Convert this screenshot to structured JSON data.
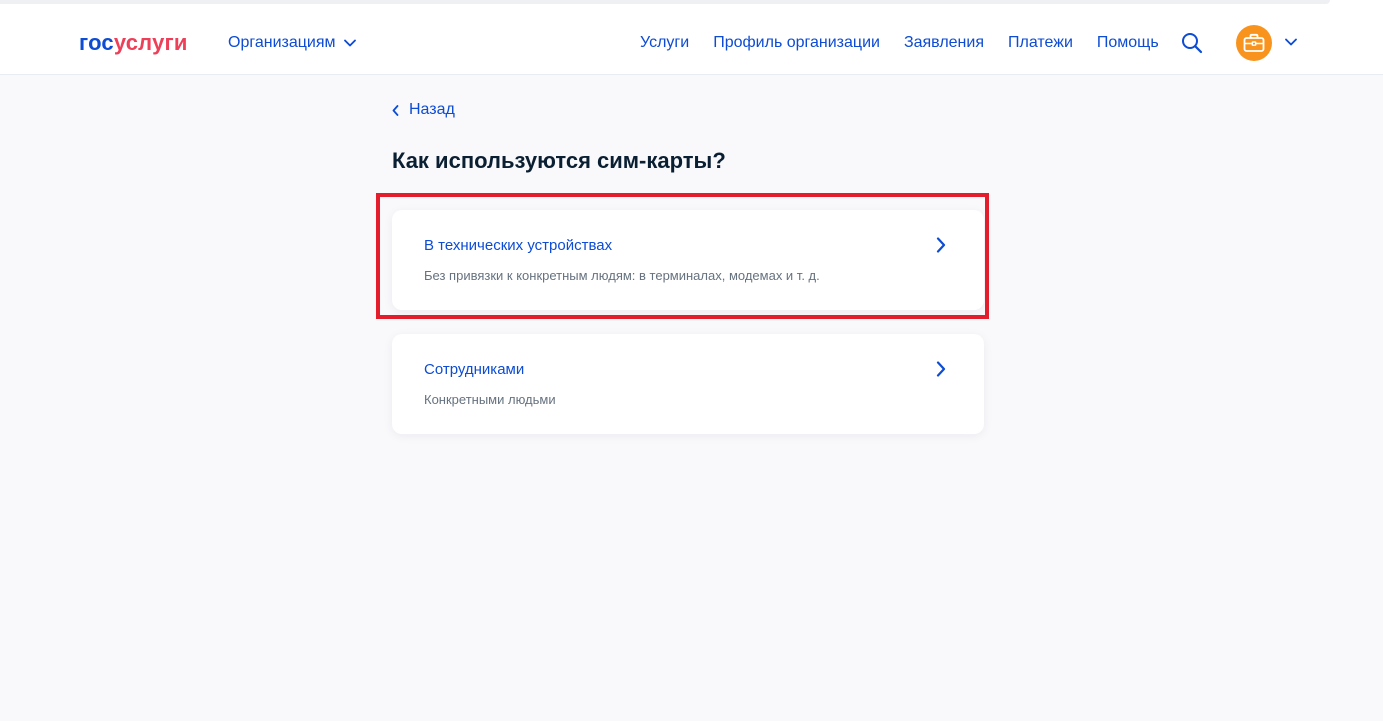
{
  "logo": {
    "part1": "гос",
    "part2": "услуги"
  },
  "header": {
    "org_menu_label": "Организациям",
    "nav": [
      "Услуги",
      "Профиль организации",
      "Заявления",
      "Платежи",
      "Помощь"
    ]
  },
  "back_label": "Назад",
  "page_title": "Как используются сим-карты?",
  "options": [
    {
      "title": "В технических устройствах",
      "description": "Без привязки к конкретным людям: в терминалах, модемах и т. д."
    },
    {
      "title": "Сотрудниками",
      "description": "Конкретными людьми"
    }
  ],
  "colors": {
    "accent": "#0d4cd3",
    "brand_red": "#ee3f58",
    "avatar": "#f8941d",
    "highlight": "#e31d2b"
  },
  "icons": {
    "search": "search-icon",
    "avatar": "briefcase-icon",
    "chevron": "chevron-down-icon",
    "arrow": "chevron-right-icon",
    "back": "chevron-left-icon"
  }
}
